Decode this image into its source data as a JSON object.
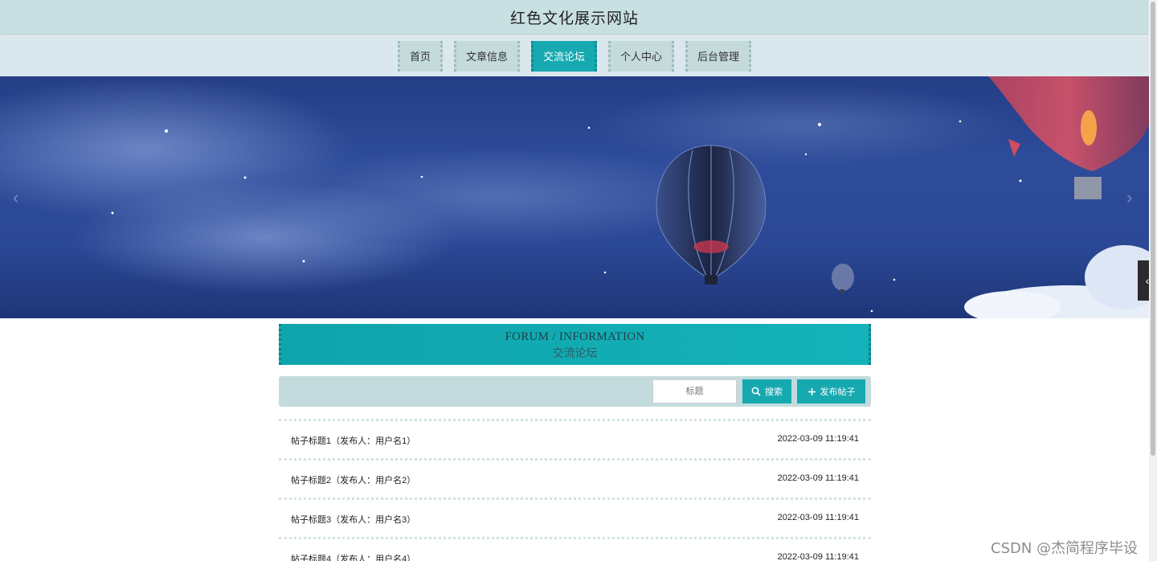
{
  "header": {
    "title": "红色文化展示网站"
  },
  "nav": {
    "items": [
      {
        "label": "首页",
        "active": false
      },
      {
        "label": "文章信息",
        "active": false
      },
      {
        "label": "交流论坛",
        "active": true
      },
      {
        "label": "个人中心",
        "active": false
      },
      {
        "label": "后台管理",
        "active": false
      }
    ]
  },
  "banner": {
    "prev_icon": "chevron-left-icon",
    "next_icon": "chevron-right-icon"
  },
  "side_tab": {
    "icon": "chevron-left-icon",
    "glyph": "‹"
  },
  "section": {
    "title_en": "FORUM / INFORMATION",
    "title_cn": "交流论坛"
  },
  "search": {
    "placeholder": "标题",
    "search_label": "搜索",
    "publish_label": "发布帖子"
  },
  "posts": [
    {
      "title": "帖子标题1（发布人：用户名1）",
      "time": "2022-03-09 11:19:41"
    },
    {
      "title": "帖子标题2（发布人：用户名2）",
      "time": "2022-03-09 11:19:41"
    },
    {
      "title": "帖子标题3（发布人：用户名3）",
      "time": "2022-03-09 11:19:41"
    },
    {
      "title": "帖子标题4（发布人：用户名4）",
      "time": "2022-03-09 11:19:41"
    }
  ],
  "colors": {
    "accent": "#16a9b0",
    "header_bg": "#c9e0e2",
    "nav_bg": "#dae8ee"
  },
  "watermark": "CSDN @杰简程序毕设"
}
